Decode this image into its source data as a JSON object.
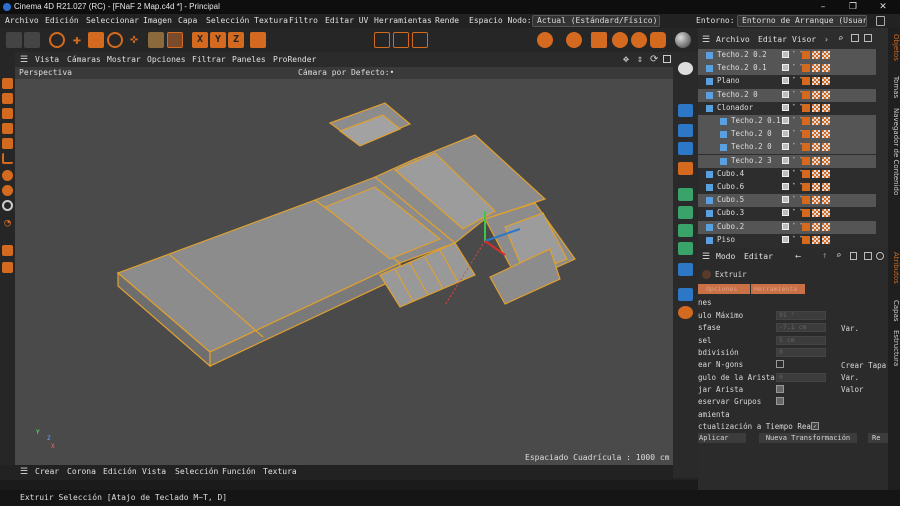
{
  "window": {
    "title": "Cinema 4D R21.027 (RC) - [FNaF 2 Map.c4d *] - Principal"
  },
  "menu": [
    "Archivo",
    "Edición",
    "Seleccionar",
    "Imagen",
    "Capa",
    "Selección Textura",
    "Filtro",
    "Editar UV",
    "Herramientas",
    "Rende"
  ],
  "node_space": {
    "label": "Espacio Nodo:",
    "value": "Actual (Estándard/Físico)"
  },
  "environment": {
    "label": "Entorno:",
    "value": "Entorno de Arranque (Usuario)"
  },
  "xyz": [
    "X",
    "Y",
    "Z"
  ],
  "viewport": {
    "menu": [
      "Vista",
      "Cámaras",
      "Mostrar",
      "Opciones",
      "Filtrar",
      "Paneles",
      "ProRender"
    ],
    "name": "Perspectiva",
    "camera": "Cámara por Defecto:•",
    "grid": "Espaciado Cuadrícula : 1000 cm",
    "axes": {
      "x": "X",
      "y": "Y",
      "z": "Z"
    }
  },
  "timeline_menu": [
    "Crear",
    "Corona",
    "Edición",
    "Vista",
    "Selección",
    "Función",
    "Textura"
  ],
  "status": "Extruir Selección [Atajo de Teclado M~T, D]",
  "objects": {
    "menu": [
      "Archivo",
      "Editar",
      "Visor"
    ],
    "rows": [
      {
        "name": "Techo.2 0.2",
        "indent": 0,
        "selected": true
      },
      {
        "name": "Techo.2 0.1",
        "indent": 0,
        "selected": true
      },
      {
        "name": "Plano",
        "indent": 0,
        "selected": false
      },
      {
        "name": "Techo.2 0",
        "indent": 0,
        "selected": true
      },
      {
        "name": "Clonador",
        "indent": 0,
        "selected": false
      },
      {
        "name": "Techo.2 0.1",
        "indent": 1,
        "selected": true
      },
      {
        "name": "Techo.2 0",
        "indent": 1,
        "selected": true
      },
      {
        "name": "Techo.2 0",
        "indent": 1,
        "selected": true
      },
      {
        "name": "Techo.2 3",
        "indent": 1,
        "selected": true
      },
      {
        "name": "Cubo.4",
        "indent": 0,
        "selected": false
      },
      {
        "name": "Cubo.6",
        "indent": 0,
        "selected": false
      },
      {
        "name": "Cubo.5",
        "indent": 0,
        "selected": true
      },
      {
        "name": "Cubo.3",
        "indent": 0,
        "selected": false
      },
      {
        "name": "Cubo.2",
        "indent": 0,
        "selected": true
      },
      {
        "name": "Piso",
        "indent": 0,
        "selected": false
      }
    ]
  },
  "attributes": {
    "menu": [
      "Modo",
      "Editar"
    ],
    "tool": "Extruir",
    "tabs": [
      "Opciones",
      "Herramienta"
    ],
    "section": "nes",
    "params": [
      {
        "label": "ulo Máximo",
        "value": "91 °"
      },
      {
        "label": "sfase",
        "value": "-7.1 cm"
      },
      {
        "label": "sel",
        "value": "5 cm"
      },
      {
        "label": "bdivisión",
        "value": "0"
      },
      {
        "label": "ear N-gons",
        "value": ""
      },
      {
        "label": "gulo de la Arista",
        "value": "0"
      },
      {
        "label": "jar Arista",
        "value": ""
      },
      {
        "label": "eservar Grupos",
        "value": ""
      }
    ],
    "right_labels": [
      "Var.",
      "Crear Tapa",
      "Var.",
      "Valor"
    ],
    "tool_section": "amienta",
    "realtime": "ctualización a Tiempo Real",
    "buttons": [
      "Aplicar",
      "Nueva Transformación",
      "Re"
    ]
  },
  "side_tabs_top": [
    "Objetos",
    "Tomas",
    "Navegador de Contenido"
  ],
  "side_tabs_bottom": [
    "Atributos",
    "Capas",
    "Estructura"
  ],
  "colors": {
    "accent": "#d46a1f",
    "selected_row": "#555555",
    "edge": "#e0a030"
  }
}
